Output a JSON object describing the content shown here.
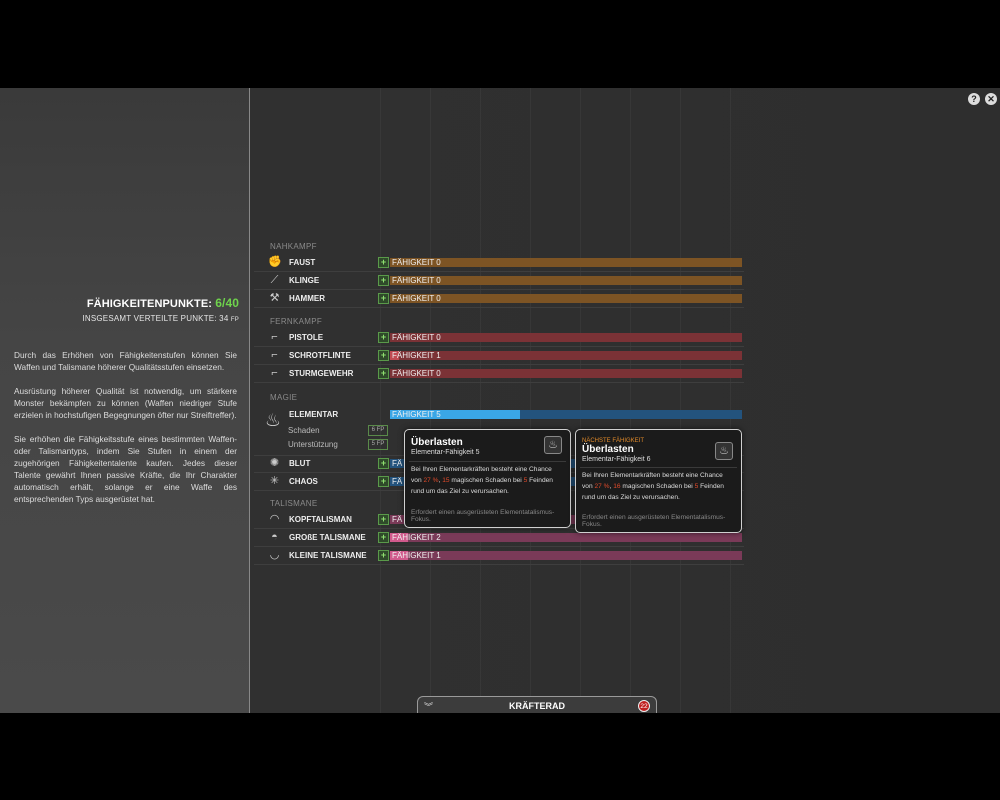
{
  "left_panel": {
    "points_label": "FÄHIGKEITENPUNKTE:",
    "points_value": "6/40",
    "distributed_label": "INSGESAMT VERTEILTE PUNKTE: 34",
    "distributed_unit": "FP",
    "paragraphs": [
      "Durch das Erhöhen von Fähigkeitenstufen können Sie Waffen und Talismane höherer Qualitätsstufen einsetzen.",
      "Ausrüstung höherer Qualität ist notwendig, um stärkere Monster bekämpfen zu können (Waffen niedriger Stufe erzielen in hochstufigen Begegnungen öfter nur Streiftreffer).",
      "Sie erhöhen die Fähigkeitsstufe eines bestimmten Waffen- oder Talismantyps, indem Sie Stufen in einem der zugehörigen Fähigkeitentalente kaufen. Jedes dieser Talente gewährt Ihnen passive Kräfte, die Ihr Charakter automatisch erhält, solange er eine Waffe des entsprechenden Typs ausgerüstet hat."
    ]
  },
  "colors": {
    "nahkampf": "#7d5424",
    "fernkampf": "#7b3236",
    "magie": "#23537d",
    "magie_highlight": "#3aa6e6",
    "talismane": "#7a3a58",
    "points_green": "#6fd34c"
  },
  "categories": {
    "nahkampf": "NAHKAMPF",
    "fernkampf": "FERNKAMPF",
    "magie": "MAGIE",
    "talismane": "TALISMANE"
  },
  "rows": {
    "faust": {
      "name": "FAUST",
      "level": "FÄHIGKEIT 0",
      "icon": "fist-icon"
    },
    "klinge": {
      "name": "KLINGE",
      "level": "FÄHIGKEIT 0",
      "icon": "blade-icon"
    },
    "hammer": {
      "name": "HAMMER",
      "level": "FÄHIGKEIT 0",
      "icon": "hammer-icon"
    },
    "pistole": {
      "name": "PISTOLE",
      "level": "FÄHIGKEIT 0",
      "icon": "pistol-icon"
    },
    "schrotflinte": {
      "name": "SCHROTFLINTE",
      "level": "FÄHIGKEIT 1",
      "icon": "shotgun-icon"
    },
    "sturmgewehr": {
      "name": "STURMGEWEHR",
      "level": "FÄHIGKEIT 0",
      "icon": "assault-rifle-icon"
    },
    "elementar": {
      "name": "ELEMENTAR",
      "level": "FÄHIGKEIT 5",
      "icon": "flame-icon",
      "progress": 0.37,
      "sub_damage": "Schaden",
      "sub_damage_badge": "6 FP",
      "sub_support": "Unterstützung",
      "sub_support_badge": "5 FP"
    },
    "blut": {
      "name": "BLUT",
      "level": "FÄ",
      "icon": "blood-icon"
    },
    "chaos": {
      "name": "CHAOS",
      "level": "FÄ",
      "icon": "chaos-icon"
    },
    "kopftalisman": {
      "name": "KOPFTALISMAN",
      "level": "FÄ",
      "icon": "head-talisman-icon"
    },
    "grosse": {
      "name": "GROßE TALISMANE",
      "level": "FÄHIGKEIT 2",
      "icon": "major-talisman-icon",
      "progress": 0.05
    },
    "kleine": {
      "name": "KLEINE TALISMANE",
      "level": "FÄHIGKEIT 1",
      "icon": "minor-talisman-icon",
      "progress": 0.05
    }
  },
  "tooltip_current": {
    "title": "Überlasten",
    "subtitle": "Elementar-Fähigkeit 5",
    "body_1": "Bei Ihren Elementarkräften besteht eine Chance von",
    "pct": "27 %",
    "mid": ",",
    "dmg": "15",
    "body_2": "magischen Schaden bei",
    "targets": "5",
    "body_3": "Feinden rund um das Ziel zu verursachen.",
    "requirement": "Erfordert einen ausgerüsteten Elementatalismus-Fokus."
  },
  "tooltip_next": {
    "heading": "NÄCHSTE FÄHIGKEIT",
    "title": "Überlasten",
    "subtitle": "Elementar-Fähigkeit 6",
    "body_1": "Bei Ihren Elementarkräften besteht eine Chance von",
    "pct": "27 %",
    "dmg": "16",
    "body_2": "magischen Schaden bei",
    "targets": "5",
    "body_3": "Feinden rund um das Ziel zu verursachen.",
    "requirement": "Erfordert einen ausgerüsteten Elementatalismus-Fokus."
  },
  "bottom_tab": {
    "label": "KRÄFTERAD",
    "badge": "22"
  },
  "corner": {
    "help": "?",
    "close": "✕"
  }
}
